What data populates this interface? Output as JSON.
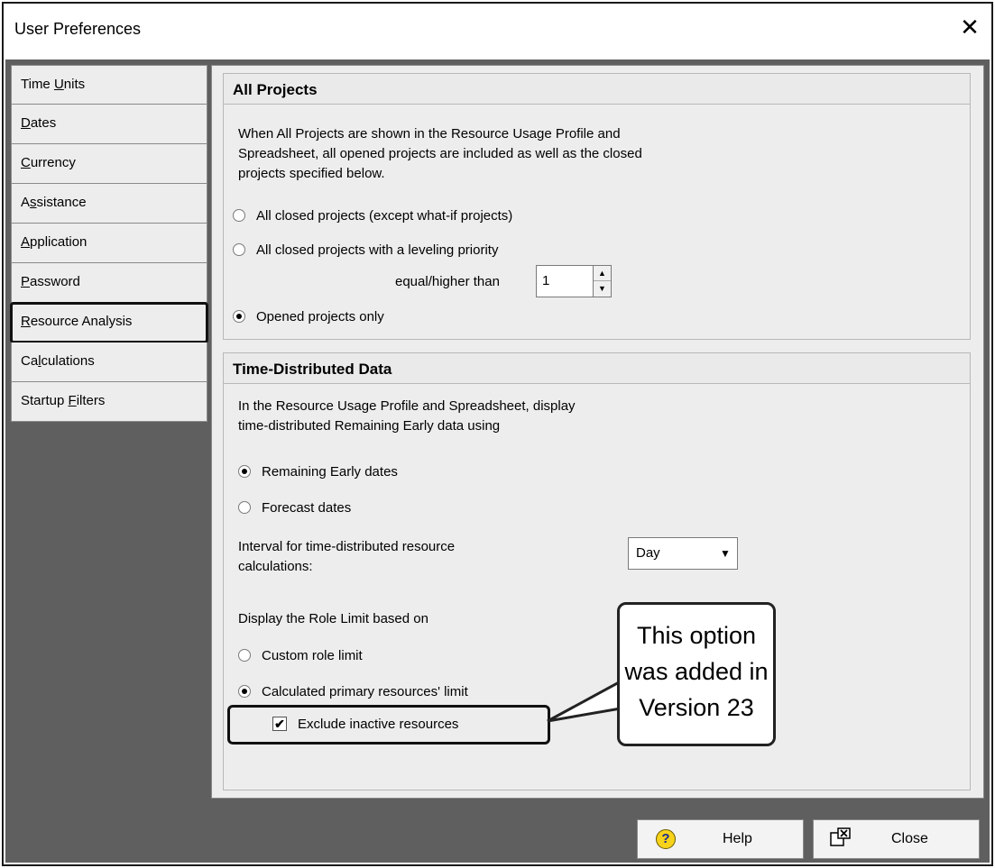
{
  "window": {
    "title": "User Preferences",
    "close_glyph": "✕"
  },
  "sidebar": {
    "items": [
      {
        "pre": "Time ",
        "u": "U",
        "post": "nits"
      },
      {
        "pre": "",
        "u": "D",
        "post": "ates"
      },
      {
        "pre": "",
        "u": "C",
        "post": "urrency"
      },
      {
        "pre": "A",
        "u": "s",
        "post": "sistance"
      },
      {
        "pre": "",
        "u": "A",
        "post": "pplication"
      },
      {
        "pre": "",
        "u": "P",
        "post": "assword"
      },
      {
        "pre": "",
        "u": "R",
        "post": "esource Analysis"
      },
      {
        "pre": "Ca",
        "u": "l",
        "post": "culations"
      },
      {
        "pre": "Startup ",
        "u": "F",
        "post": "ilters"
      }
    ],
    "selected_index": 6
  },
  "all_projects": {
    "heading": "All Projects",
    "desc_line1": "When All Projects are shown in the Resource Usage Profile and",
    "desc_line2": "Spreadsheet, all opened projects are included as well as the closed",
    "desc_line3": "projects specified below.",
    "opt_closed_all": "All closed projects (except what-if projects)",
    "opt_closed_priority": "All closed projects with a leveling priority",
    "priority_label": "equal/higher than",
    "priority_value": "1",
    "opt_opened_only": "Opened projects only",
    "selected": "opened_only"
  },
  "time_distributed": {
    "heading": "Time-Distributed Data",
    "desc_line1": "In the Resource Usage Profile and Spreadsheet, display",
    "desc_line2": "time-distributed Remaining Early data using",
    "opt_remaining_early": "Remaining Early dates",
    "opt_forecast": "Forecast dates",
    "interval_label_line1": "Interval for time-distributed resource",
    "interval_label_line2": "calculations:",
    "interval_value": "Day",
    "role_limit_label": "Display the Role Limit based on",
    "opt_custom_role": "Custom role limit",
    "opt_calculated_primary": "Calculated primary resources' limit",
    "exclude_inactive": "Exclude inactive resources",
    "exclude_inactive_checked": true
  },
  "callout": {
    "line1": "This option",
    "line2": "was added in",
    "line3": "Version 23"
  },
  "footer": {
    "help_label": "Help",
    "close_label": "Close"
  }
}
